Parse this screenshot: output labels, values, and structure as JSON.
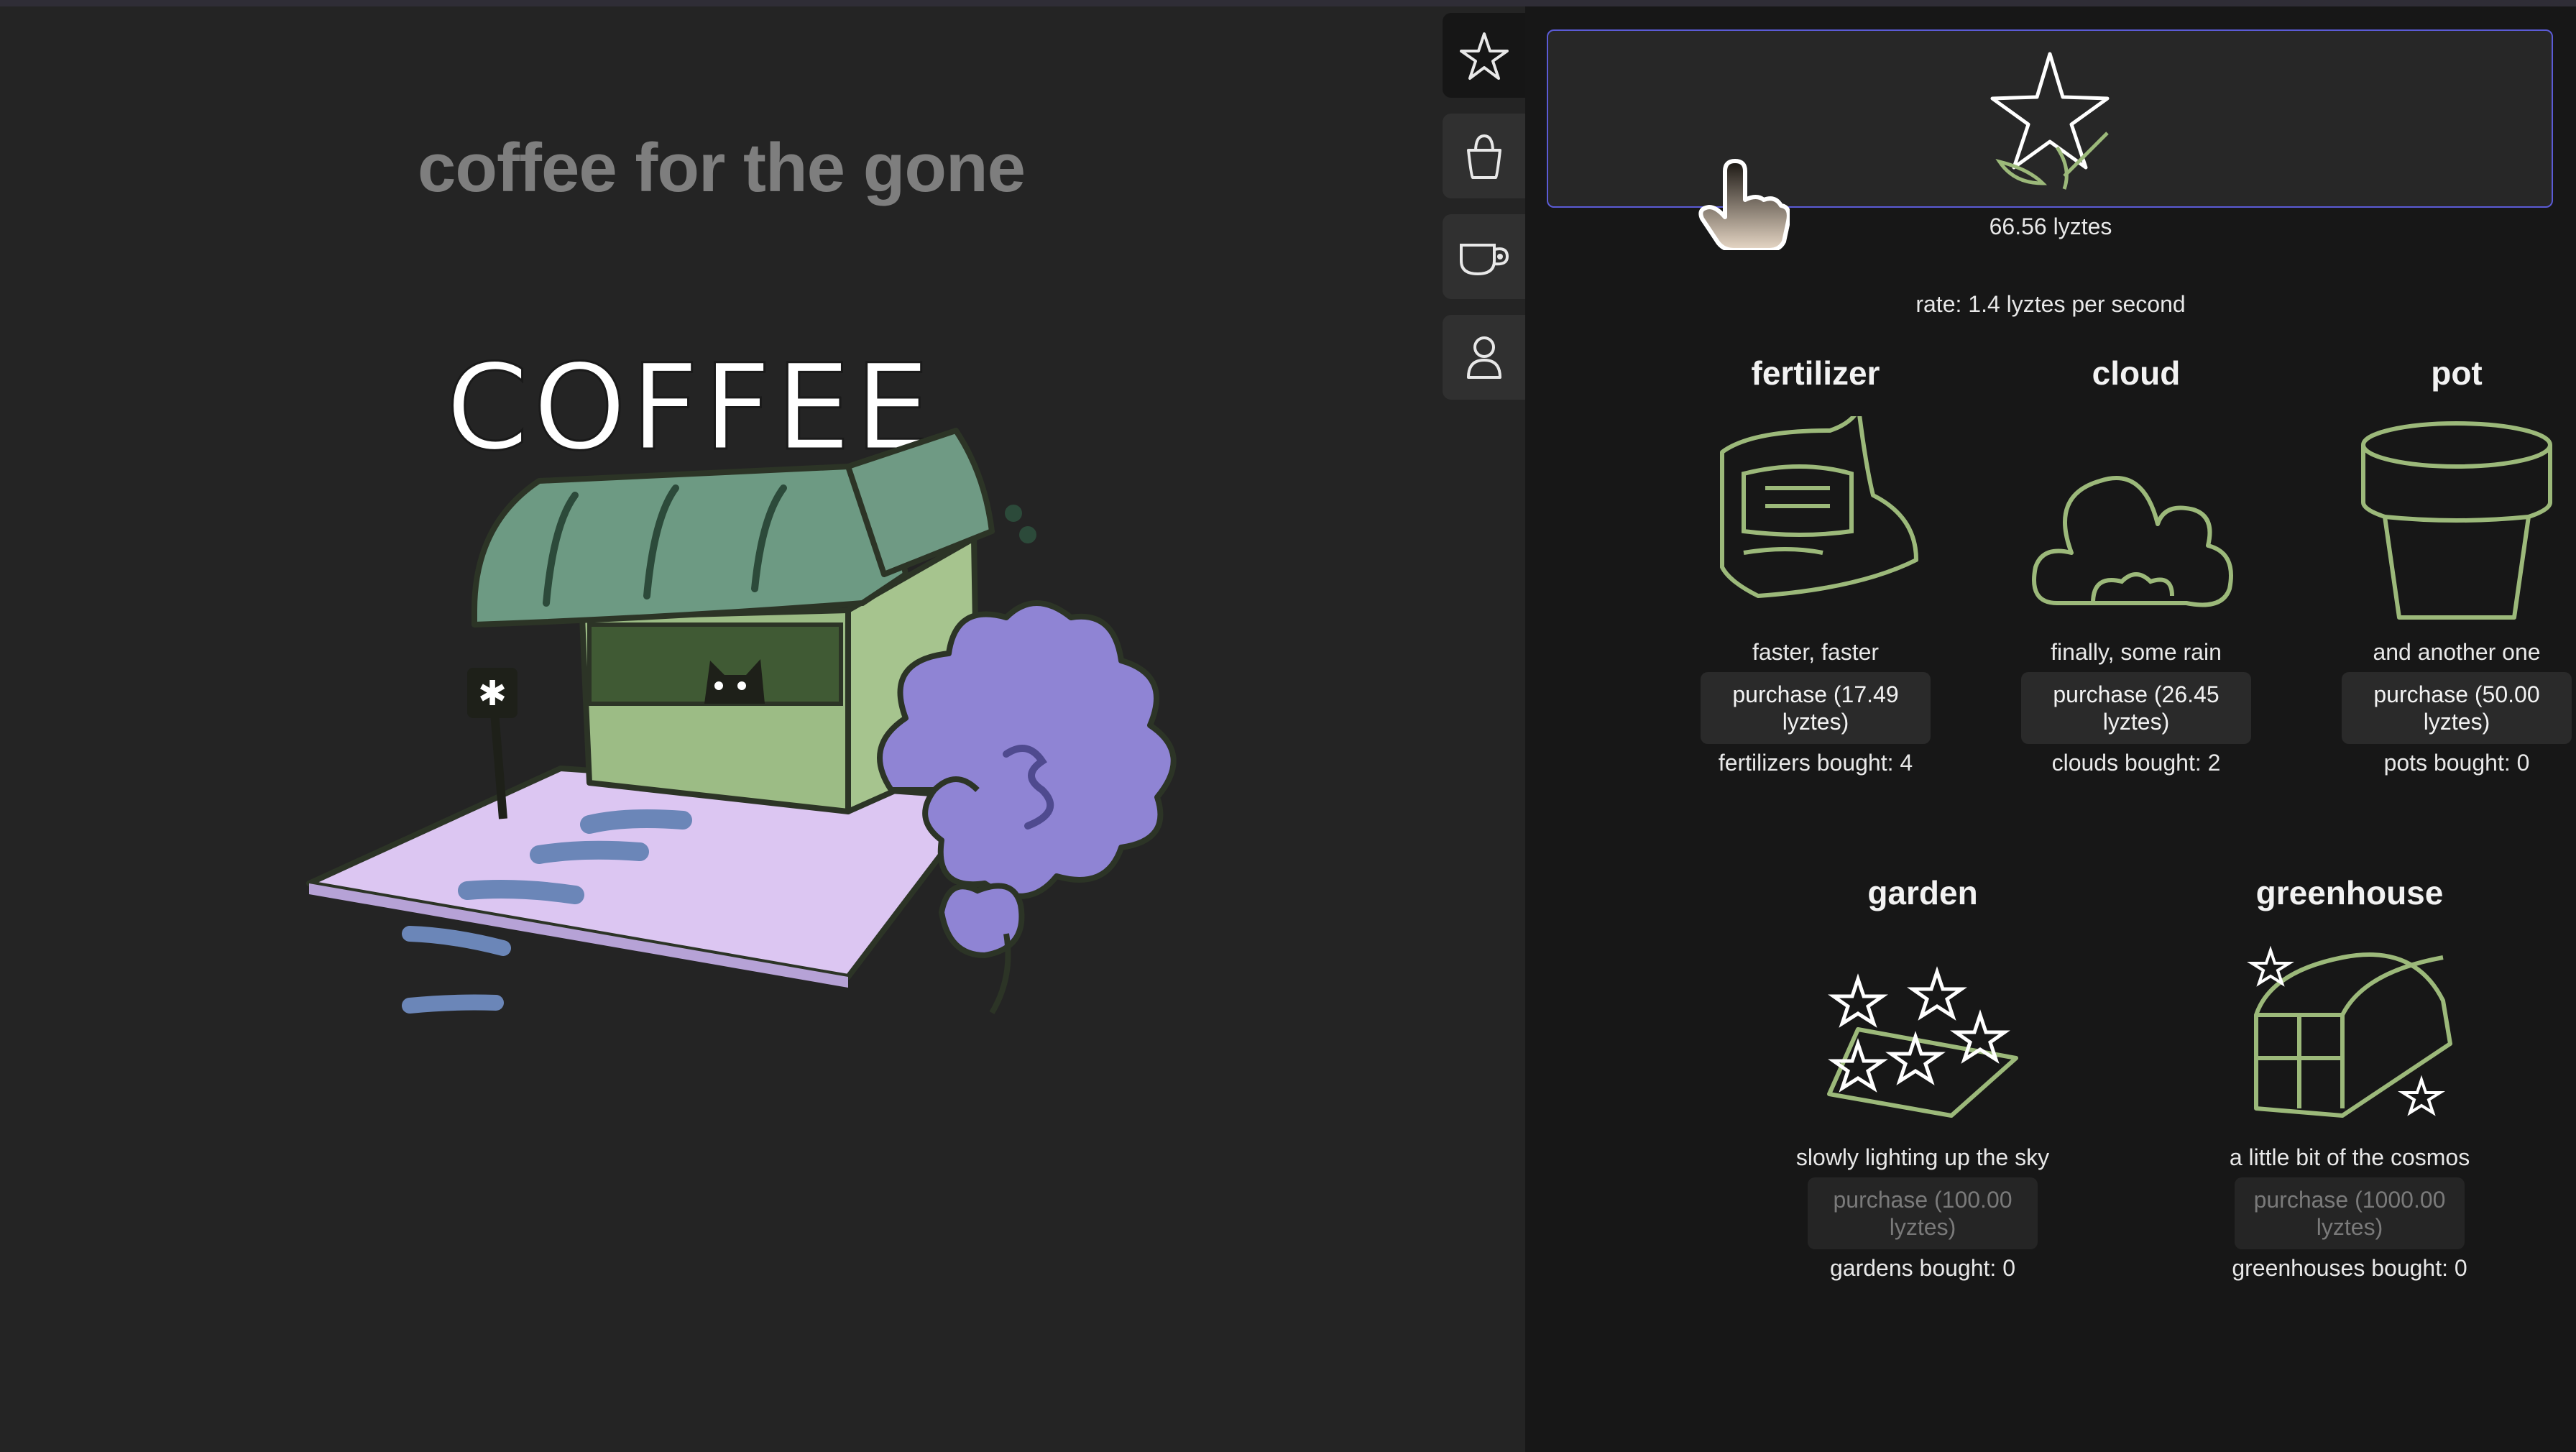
{
  "game": {
    "title": "coffee for the gone",
    "shop_sign": "COFFEE"
  },
  "nav": {
    "items": [
      {
        "icon": "star-icon",
        "active": true
      },
      {
        "icon": "bag-icon",
        "active": false
      },
      {
        "icon": "coffee-cup-icon",
        "active": false
      },
      {
        "icon": "person-icon",
        "active": false
      }
    ]
  },
  "stats": {
    "balance": "66.56 lyztes",
    "rate": "rate: 1.4 lyztes per second"
  },
  "items": [
    {
      "title": "fertilizer",
      "icon": "fertilizer-bag-icon",
      "description": "faster, faster",
      "button": "purchase (17.49 lyztes)",
      "bought": "fertilizers bought: 4",
      "affordable": true
    },
    {
      "title": "cloud",
      "icon": "cloud-icon",
      "description": "finally, some rain",
      "button": "purchase (26.45 lyztes)",
      "bought": "clouds bought: 2",
      "affordable": true
    },
    {
      "title": "pot",
      "icon": "pot-icon",
      "description": "and another one",
      "button": "purchase (50.00 lyztes)",
      "bought": "pots bought: 0",
      "affordable": true
    },
    {
      "title": "garden",
      "icon": "garden-icon",
      "description": "slowly lighting up the sky",
      "button": "purchase (100.00 lyztes)",
      "bought": "gardens bought: 0",
      "affordable": false
    },
    {
      "title": "greenhouse",
      "icon": "greenhouse-icon",
      "description": "a little bit of the cosmos",
      "button": "purchase (1000.00 lyztes)",
      "bought": "greenhouses bought: 0",
      "affordable": false
    }
  ],
  "colors": {
    "accent_border": "#5b5bd6",
    "plant_green": "#9cb97a",
    "lavender": "#8f84d4"
  }
}
